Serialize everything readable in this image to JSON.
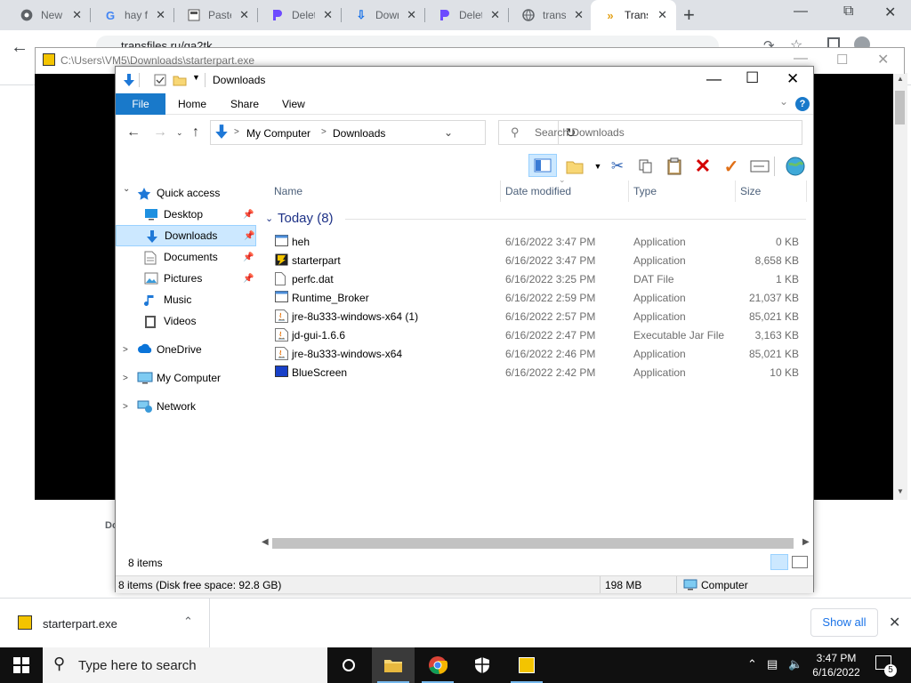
{
  "browser": {
    "tabs": [
      {
        "title": "New Tab",
        "icon": "chrome-icon"
      },
      {
        "title": "hay for",
        "icon": "google-icon"
      },
      {
        "title": "Paste",
        "icon": "paste-icon"
      },
      {
        "title": "Delete",
        "icon": "proton-icon"
      },
      {
        "title": "Downloads",
        "icon": "download-icon"
      },
      {
        "title": "Delete",
        "icon": "proton-icon"
      },
      {
        "title": "transfer",
        "icon": "globe-icon"
      },
      {
        "title": "Transfer",
        "icon": "transfer-icon"
      }
    ],
    "address": "transfiles.ru/ga2tk",
    "page_fragment": "Do"
  },
  "outer_window": {
    "title": "C:\\Users\\VM5\\Downloads\\starterpart.exe"
  },
  "explorer": {
    "title": "Downloads",
    "ribbon_tabs": [
      "File",
      "Home",
      "Share",
      "View"
    ],
    "breadcrumb": [
      "My Computer",
      "Downloads"
    ],
    "search_placeholder": "Search Downloads",
    "nav_items": [
      {
        "label": "Quick access",
        "icon": "star-icon",
        "level": 0,
        "expandable": true,
        "expanded": true,
        "pinned": false,
        "selected": false
      },
      {
        "label": "Desktop",
        "icon": "desktop-icon",
        "level": 1,
        "expandable": false,
        "pinned": true,
        "selected": false
      },
      {
        "label": "Downloads",
        "icon": "download-icon",
        "level": 1,
        "expandable": false,
        "pinned": true,
        "selected": true
      },
      {
        "label": "Documents",
        "icon": "document-icon",
        "level": 1,
        "expandable": false,
        "pinned": true,
        "selected": false
      },
      {
        "label": "Pictures",
        "icon": "picture-icon",
        "level": 1,
        "expandable": false,
        "pinned": true,
        "selected": false
      },
      {
        "label": "Music",
        "icon": "music-icon",
        "level": 1,
        "expandable": false,
        "pinned": false,
        "selected": false
      },
      {
        "label": "Videos",
        "icon": "video-icon",
        "level": 1,
        "expandable": false,
        "pinned": false,
        "selected": false
      },
      {
        "label": "OneDrive",
        "icon": "cloud-icon",
        "level": 0,
        "expandable": true,
        "expanded": false,
        "pinned": false,
        "selected": false
      },
      {
        "label": "My Computer",
        "icon": "computer-icon",
        "level": 0,
        "expandable": true,
        "expanded": false,
        "pinned": false,
        "selected": false
      },
      {
        "label": "Network",
        "icon": "network-icon",
        "level": 0,
        "expandable": true,
        "expanded": false,
        "pinned": false,
        "selected": false
      }
    ],
    "columns": [
      "Name",
      "Date modified",
      "Type",
      "Size"
    ],
    "group_label": "Today (8)",
    "files": [
      {
        "name": "heh",
        "date": "6/16/2022 3:47 PM",
        "type": "Application",
        "size": "0 KB",
        "icon": "app-window-icon"
      },
      {
        "name": "starterpart",
        "date": "6/16/2022 3:47 PM",
        "type": "Application",
        "size": "8,658 KB",
        "icon": "starterpart-icon"
      },
      {
        "name": "perfc.dat",
        "date": "6/16/2022 3:25 PM",
        "type": "DAT File",
        "size": "1 KB",
        "icon": "blank-file-icon"
      },
      {
        "name": "Runtime_Broker",
        "date": "6/16/2022 2:59 PM",
        "type": "Application",
        "size": "21,037 KB",
        "icon": "app-window-icon"
      },
      {
        "name": "jre-8u333-windows-x64 (1)",
        "date": "6/16/2022 2:57 PM",
        "type": "Application",
        "size": "85,021 KB",
        "icon": "java-icon"
      },
      {
        "name": "jd-gui-1.6.6",
        "date": "6/16/2022 2:47 PM",
        "type": "Executable Jar File",
        "size": "3,163 KB",
        "icon": "java-icon"
      },
      {
        "name": "jre-8u333-windows-x64",
        "date": "6/16/2022 2:46 PM",
        "type": "Application",
        "size": "85,021 KB",
        "icon": "java-icon"
      },
      {
        "name": "BlueScreen",
        "date": "6/16/2022 2:42 PM",
        "type": "Application",
        "size": "10 KB",
        "icon": "bluescreen-icon"
      }
    ],
    "status_items": "8 items",
    "info_left": "8 items (Disk free space: 92.8 GB)",
    "info_size": "198 MB",
    "info_location": "Computer"
  },
  "downloads_shelf": {
    "file": "starterpart.exe",
    "show_all": "Show all"
  },
  "taskbar": {
    "search_placeholder": "Type here to search",
    "time": "3:47 PM",
    "date": "6/16/2022",
    "notification_count": "5"
  }
}
